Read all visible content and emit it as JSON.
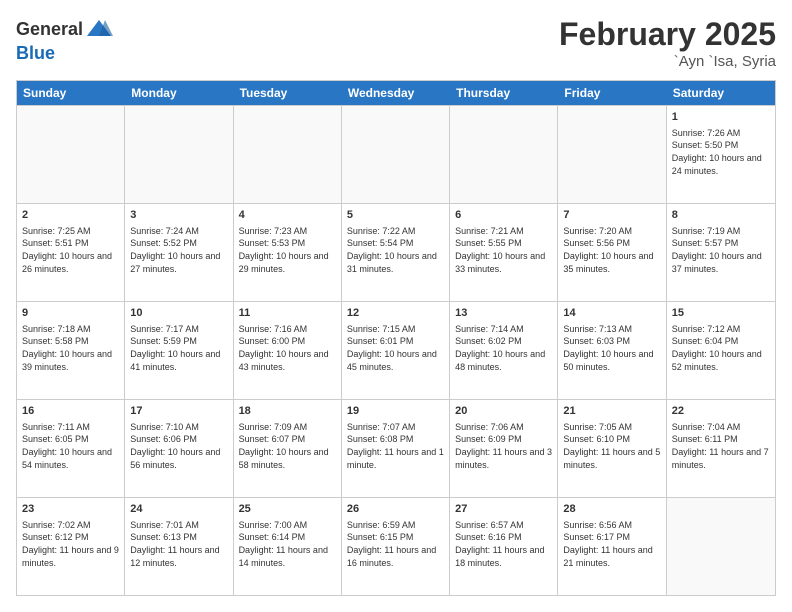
{
  "header": {
    "logo_line1": "General",
    "logo_line2": "Blue",
    "title": "February 2025",
    "location": "`Ayn `Isa, Syria"
  },
  "weekdays": [
    "Sunday",
    "Monday",
    "Tuesday",
    "Wednesday",
    "Thursday",
    "Friday",
    "Saturday"
  ],
  "rows": [
    [
      {
        "day": "",
        "empty": true
      },
      {
        "day": "",
        "empty": true
      },
      {
        "day": "",
        "empty": true
      },
      {
        "day": "",
        "empty": true
      },
      {
        "day": "",
        "empty": true
      },
      {
        "day": "",
        "empty": true
      },
      {
        "day": "1",
        "text": "Sunrise: 7:26 AM\nSunset: 5:50 PM\nDaylight: 10 hours and 24 minutes."
      }
    ],
    [
      {
        "day": "2",
        "text": "Sunrise: 7:25 AM\nSunset: 5:51 PM\nDaylight: 10 hours and 26 minutes."
      },
      {
        "day": "3",
        "text": "Sunrise: 7:24 AM\nSunset: 5:52 PM\nDaylight: 10 hours and 27 minutes."
      },
      {
        "day": "4",
        "text": "Sunrise: 7:23 AM\nSunset: 5:53 PM\nDaylight: 10 hours and 29 minutes."
      },
      {
        "day": "5",
        "text": "Sunrise: 7:22 AM\nSunset: 5:54 PM\nDaylight: 10 hours and 31 minutes."
      },
      {
        "day": "6",
        "text": "Sunrise: 7:21 AM\nSunset: 5:55 PM\nDaylight: 10 hours and 33 minutes."
      },
      {
        "day": "7",
        "text": "Sunrise: 7:20 AM\nSunset: 5:56 PM\nDaylight: 10 hours and 35 minutes."
      },
      {
        "day": "8",
        "text": "Sunrise: 7:19 AM\nSunset: 5:57 PM\nDaylight: 10 hours and 37 minutes."
      }
    ],
    [
      {
        "day": "9",
        "text": "Sunrise: 7:18 AM\nSunset: 5:58 PM\nDaylight: 10 hours and 39 minutes."
      },
      {
        "day": "10",
        "text": "Sunrise: 7:17 AM\nSunset: 5:59 PM\nDaylight: 10 hours and 41 minutes."
      },
      {
        "day": "11",
        "text": "Sunrise: 7:16 AM\nSunset: 6:00 PM\nDaylight: 10 hours and 43 minutes."
      },
      {
        "day": "12",
        "text": "Sunrise: 7:15 AM\nSunset: 6:01 PM\nDaylight: 10 hours and 45 minutes."
      },
      {
        "day": "13",
        "text": "Sunrise: 7:14 AM\nSunset: 6:02 PM\nDaylight: 10 hours and 48 minutes."
      },
      {
        "day": "14",
        "text": "Sunrise: 7:13 AM\nSunset: 6:03 PM\nDaylight: 10 hours and 50 minutes."
      },
      {
        "day": "15",
        "text": "Sunrise: 7:12 AM\nSunset: 6:04 PM\nDaylight: 10 hours and 52 minutes."
      }
    ],
    [
      {
        "day": "16",
        "text": "Sunrise: 7:11 AM\nSunset: 6:05 PM\nDaylight: 10 hours and 54 minutes."
      },
      {
        "day": "17",
        "text": "Sunrise: 7:10 AM\nSunset: 6:06 PM\nDaylight: 10 hours and 56 minutes."
      },
      {
        "day": "18",
        "text": "Sunrise: 7:09 AM\nSunset: 6:07 PM\nDaylight: 10 hours and 58 minutes."
      },
      {
        "day": "19",
        "text": "Sunrise: 7:07 AM\nSunset: 6:08 PM\nDaylight: 11 hours and 1 minute."
      },
      {
        "day": "20",
        "text": "Sunrise: 7:06 AM\nSunset: 6:09 PM\nDaylight: 11 hours and 3 minutes."
      },
      {
        "day": "21",
        "text": "Sunrise: 7:05 AM\nSunset: 6:10 PM\nDaylight: 11 hours and 5 minutes."
      },
      {
        "day": "22",
        "text": "Sunrise: 7:04 AM\nSunset: 6:11 PM\nDaylight: 11 hours and 7 minutes."
      }
    ],
    [
      {
        "day": "23",
        "text": "Sunrise: 7:02 AM\nSunset: 6:12 PM\nDaylight: 11 hours and 9 minutes."
      },
      {
        "day": "24",
        "text": "Sunrise: 7:01 AM\nSunset: 6:13 PM\nDaylight: 11 hours and 12 minutes."
      },
      {
        "day": "25",
        "text": "Sunrise: 7:00 AM\nSunset: 6:14 PM\nDaylight: 11 hours and 14 minutes."
      },
      {
        "day": "26",
        "text": "Sunrise: 6:59 AM\nSunset: 6:15 PM\nDaylight: 11 hours and 16 minutes."
      },
      {
        "day": "27",
        "text": "Sunrise: 6:57 AM\nSunset: 6:16 PM\nDaylight: 11 hours and 18 minutes."
      },
      {
        "day": "28",
        "text": "Sunrise: 6:56 AM\nSunset: 6:17 PM\nDaylight: 11 hours and 21 minutes."
      },
      {
        "day": "",
        "empty": true
      }
    ]
  ]
}
